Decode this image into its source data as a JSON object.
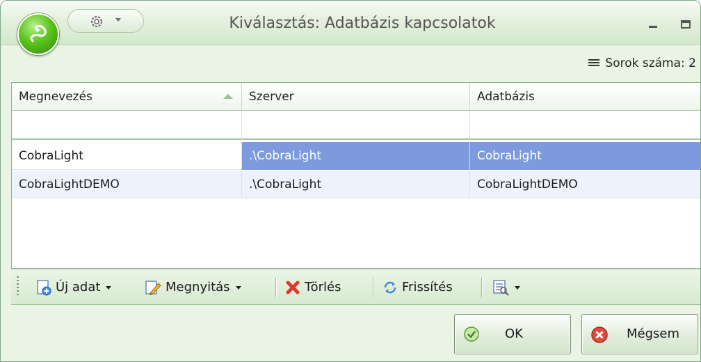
{
  "window": {
    "title": "Kiválasztás: Adatbázis kapcsolatok"
  },
  "row_count_label": "Sorok száma: 2",
  "grid": {
    "columns": [
      "Megnevezés",
      "Szerver",
      "Adatbázis"
    ],
    "rows": [
      [
        "CobraLight",
        ".\\CobraLight",
        "CobraLight"
      ],
      [
        "CobraLightDEMO",
        ".\\CobraLight",
        "CobraLightDEMO"
      ]
    ],
    "selected_row": 0
  },
  "toolbar": {
    "new_label": "Új adat",
    "open_label": "Megnyitás",
    "delete_label": "Törlés",
    "refresh_label": "Frissítés"
  },
  "buttons": {
    "ok_label": "OK",
    "cancel_label": "Mégsem"
  },
  "colors": {
    "selection": "#7d9bdc",
    "orb_green": "#5cc41e",
    "frame_green": "#e9f4e4"
  },
  "icons": {
    "app_orb": "snake-logo-icon",
    "qat": "gear-icon",
    "rowcount": "list-lines-icon",
    "new": "new-document-icon",
    "open": "edit-pencil-icon",
    "delete": "delete-x-icon",
    "refresh": "refresh-icon",
    "columns": "column-chooser-icon",
    "ok": "check-circle-icon",
    "cancel": "cancel-circle-icon"
  }
}
